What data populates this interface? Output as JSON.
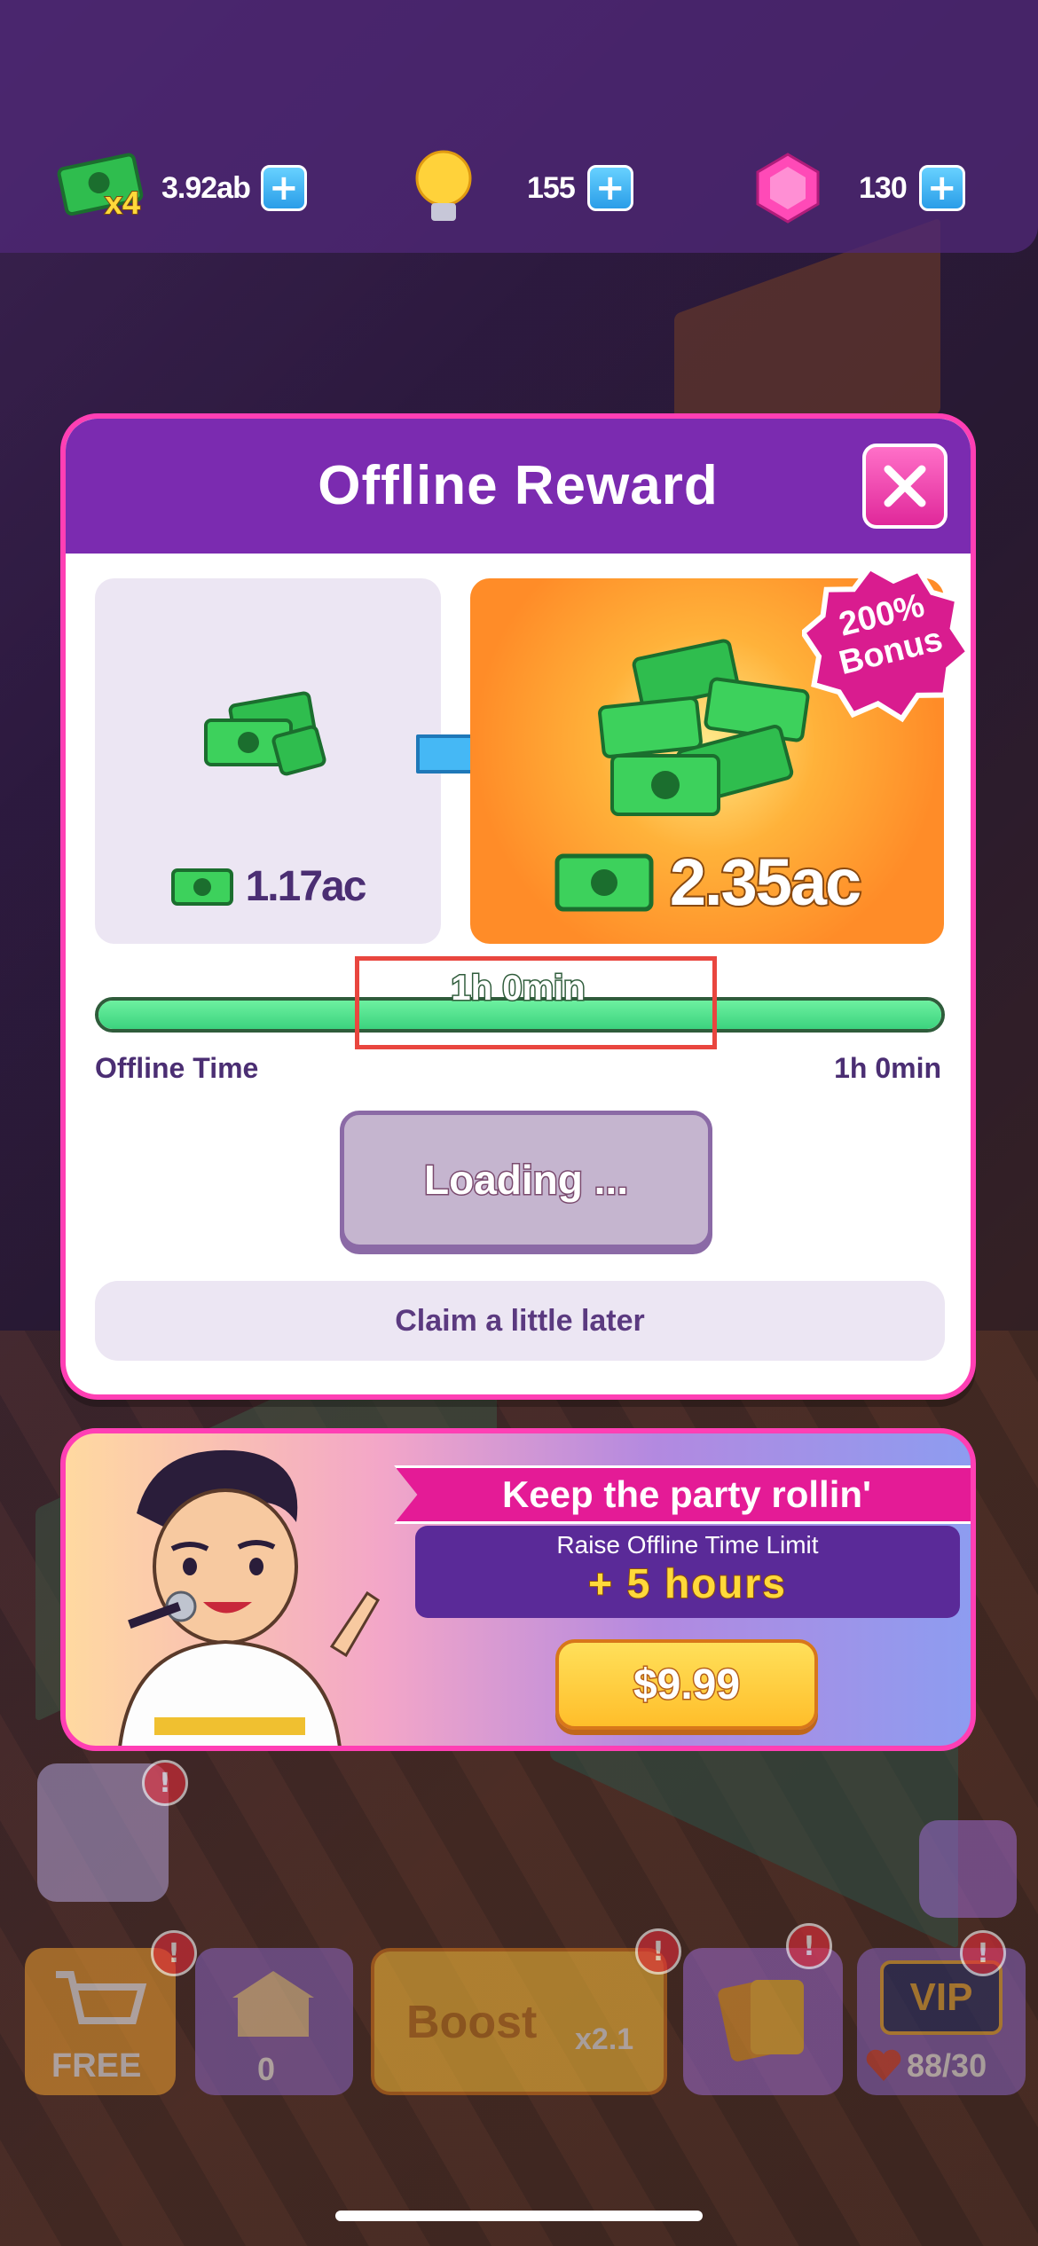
{
  "resources": {
    "cash": {
      "multiplier": "x4",
      "value": "3.92ab"
    },
    "bulbs": {
      "value": "155"
    },
    "gems": {
      "value": "130"
    }
  },
  "modal": {
    "title": "Offline Reward",
    "base_amount": "1.17ac",
    "bonus_amount": "2.35ac",
    "bonus_badge_line1": "200%",
    "bonus_badge_line2": "Bonus",
    "progress_label": "1h 0min",
    "progress_fraction": 1.0,
    "offline_time_label": "Offline Time",
    "offline_time_value": "1h 0min",
    "loading_label": "Loading ...",
    "claim_later_label": "Claim a little later"
  },
  "promo": {
    "title": "Keep the party rollin'",
    "subtitle": "Raise Offline Time Limit",
    "bonus": "+ 5 hours",
    "price": "$9.99"
  },
  "bottom_nav": {
    "shop_label": "FREE",
    "home_count": "0",
    "boost_label": "Boost",
    "boost_multiplier": "x2.1",
    "vip_label": "VIP",
    "lives": "88/30"
  },
  "colors": {
    "accent_pink": "#ff3fb4",
    "header_purple": "#7b2bb0",
    "progress_green": "#3cd37e",
    "highlight_red": "#e9463f"
  }
}
